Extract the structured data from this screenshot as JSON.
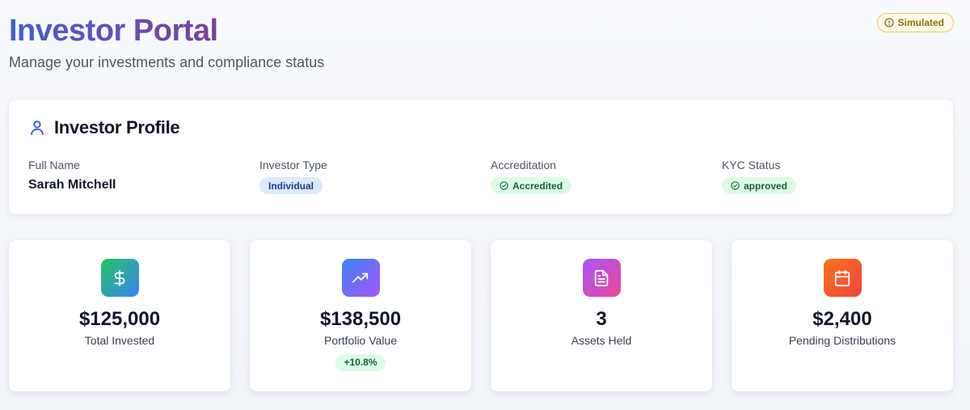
{
  "header": {
    "title": "Investor Portal",
    "subtitle": "Manage your investments and compliance status",
    "badge": "Simulated"
  },
  "profile": {
    "title": "Investor Profile",
    "icon": "user-icon",
    "fields": [
      {
        "label": "Full Name",
        "value": "Sarah Mitchell"
      },
      {
        "label": "Investor Type",
        "value": "Individual"
      },
      {
        "label": "Accreditation",
        "value": "Accredited"
      },
      {
        "label": "KYC Status",
        "value": "approved"
      }
    ]
  },
  "stats": [
    {
      "icon": "dollar-icon",
      "value": "$125,000",
      "label": "Total Invested"
    },
    {
      "icon": "trending-up-icon",
      "value": "$138,500",
      "label": "Portfolio Value",
      "change": "+10.8%"
    },
    {
      "icon": "document-icon",
      "value": "3",
      "label": "Assets Held"
    },
    {
      "icon": "calendar-icon",
      "value": "$2,400",
      "label": "Pending Distributions"
    }
  ],
  "colors": {
    "accent_blue": "#3f5fd6",
    "accent_purple": "#7b3f95",
    "success_bg": "#dcfce7",
    "success_text": "#166534",
    "info_bg": "#dbeafe",
    "warning_border": "#f2c94c"
  }
}
